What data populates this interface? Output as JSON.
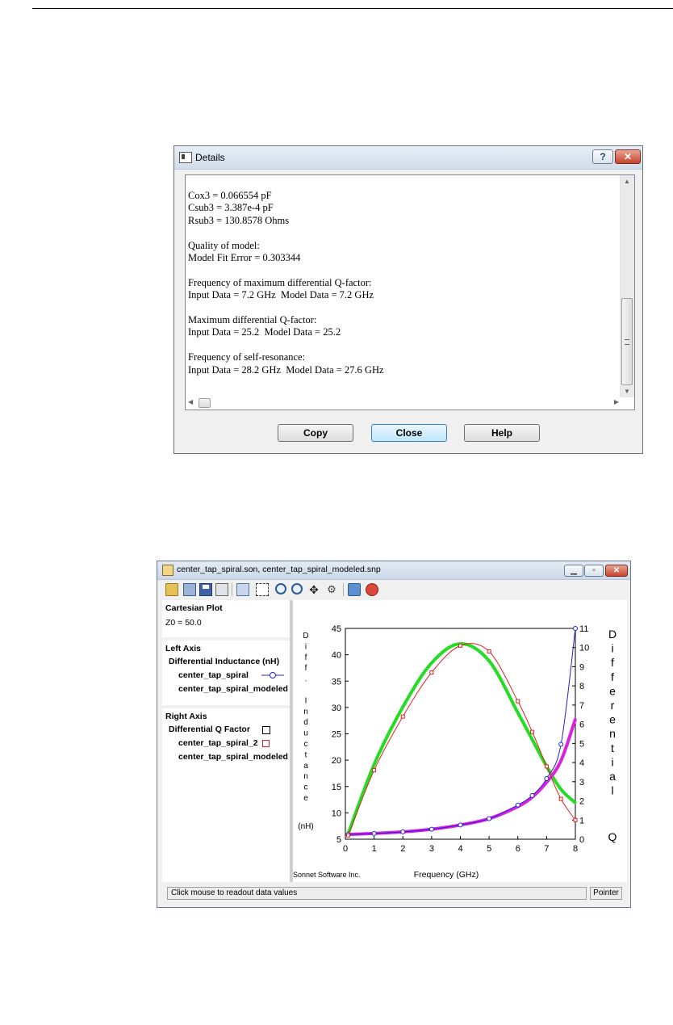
{
  "details_dialog": {
    "title": "Details",
    "help_glyph": "?",
    "close_glyph": "✕",
    "lines": [
      "Cox3 = 0.066554 pF",
      "Csub3 = 3.387e-4 pF",
      "Rsub3 = 130.8578 Ohms",
      "",
      "Quality of model:",
      "Model Fit Error = 0.303344",
      "",
      "Frequency of maximum differential Q-factor:",
      "Input Data = 7.2 GHz  Model Data = 7.2 GHz",
      "",
      "Maximum differential Q-factor:",
      "Input Data = 25.2  Model Data = 25.2",
      "",
      "Frequency of self-resonance:",
      "Input Data = 28.2 GHz  Model Data = 27.6 GHz"
    ],
    "buttons": {
      "copy": "Copy",
      "close": "Close",
      "help": "Help"
    }
  },
  "plot_window": {
    "title": "center_tap_spiral.son, center_tap_spiral_modeled.snp",
    "toolbar_icons": [
      "open-icon",
      "save-as-icon",
      "save-icon",
      "print-icon",
      "copy-icon",
      "select-icon",
      "zoom-in-icon",
      "zoom-out-icon",
      "pan-icon",
      "settings-icon",
      "refresh-icon",
      "stop-icon"
    ],
    "left_panel": {
      "cartesian": {
        "heading": "Cartesian Plot",
        "z0": "Z0 = 50.0"
      },
      "left_axis": {
        "heading": "Left Axis",
        "quantity": "Differential Inductance (nH)",
        "traces": [
          "center_tap_spiral",
          "center_tap_spiral_modeled"
        ]
      },
      "right_axis": {
        "heading": "Right Axis",
        "quantity": "Differential Q Factor",
        "traces": [
          "center_tap_spiral_2",
          "center_tap_spiral_modeled"
        ]
      }
    },
    "status": "Click mouse to readout data values",
    "pointer_label": "Pointer",
    "credit": "Sonnet Software Inc."
  },
  "chart_data": {
    "type": "line",
    "xlabel": "Frequency (GHz)",
    "ylabel_left": "Diff. Inductance",
    "ylabel_left_unit": "(nH)",
    "ylabel_right": "Differential Q",
    "xlim": [
      0,
      8
    ],
    "ylim_left": [
      5,
      45
    ],
    "ylim_right": [
      0,
      11
    ],
    "x_ticks": [
      "0",
      "1",
      "2",
      "3",
      "4",
      "5",
      "6",
      "7",
      "8"
    ],
    "y_left_ticks": [
      "5",
      "10",
      "15",
      "20",
      "25",
      "30",
      "35",
      "40",
      "45"
    ],
    "y_right_ticks": [
      "0",
      "1",
      "2",
      "3",
      "4",
      "5",
      "6",
      "7",
      "8",
      "9",
      "10",
      "11"
    ],
    "grid": false,
    "x": [
      0.1,
      1,
      2,
      3,
      4,
      5,
      6,
      6.5,
      7,
      7.5,
      8
    ],
    "series": [
      {
        "name": "center_tap_spiral",
        "axis": "left",
        "color": "#2222cc",
        "values": [
          5.9,
          6.1,
          6.4,
          6.9,
          7.7,
          8.9,
          11.5,
          13.3,
          16.5,
          23.0,
          45.0
        ]
      },
      {
        "name": "center_tap_spiral_modeled",
        "axis": "left",
        "color": "#dd22dd",
        "values": [
          5.9,
          6.1,
          6.4,
          6.9,
          7.7,
          8.9,
          11.2,
          13.0,
          15.8,
          19.9,
          27.8
        ]
      },
      {
        "name": "center_tap_spiral_2",
        "axis": "right",
        "color": "#dd2222",
        "values": [
          0.2,
          3.6,
          6.4,
          8.7,
          10.1,
          9.8,
          7.2,
          5.6,
          3.8,
          2.1,
          1.0
        ]
      },
      {
        "name": "center_tap_spiral_modeled",
        "axis": "right",
        "color": "#22dd22",
        "values": [
          0.3,
          3.9,
          6.9,
          9.2,
          10.2,
          9.3,
          6.6,
          5.2,
          3.8,
          2.6,
          1.9
        ]
      }
    ]
  },
  "colors": {
    "trace_blue": "#2222cc",
    "trace_red": "#dd2222",
    "trace_green": "#22dd22",
    "trace_magenta": "#dd22dd"
  }
}
